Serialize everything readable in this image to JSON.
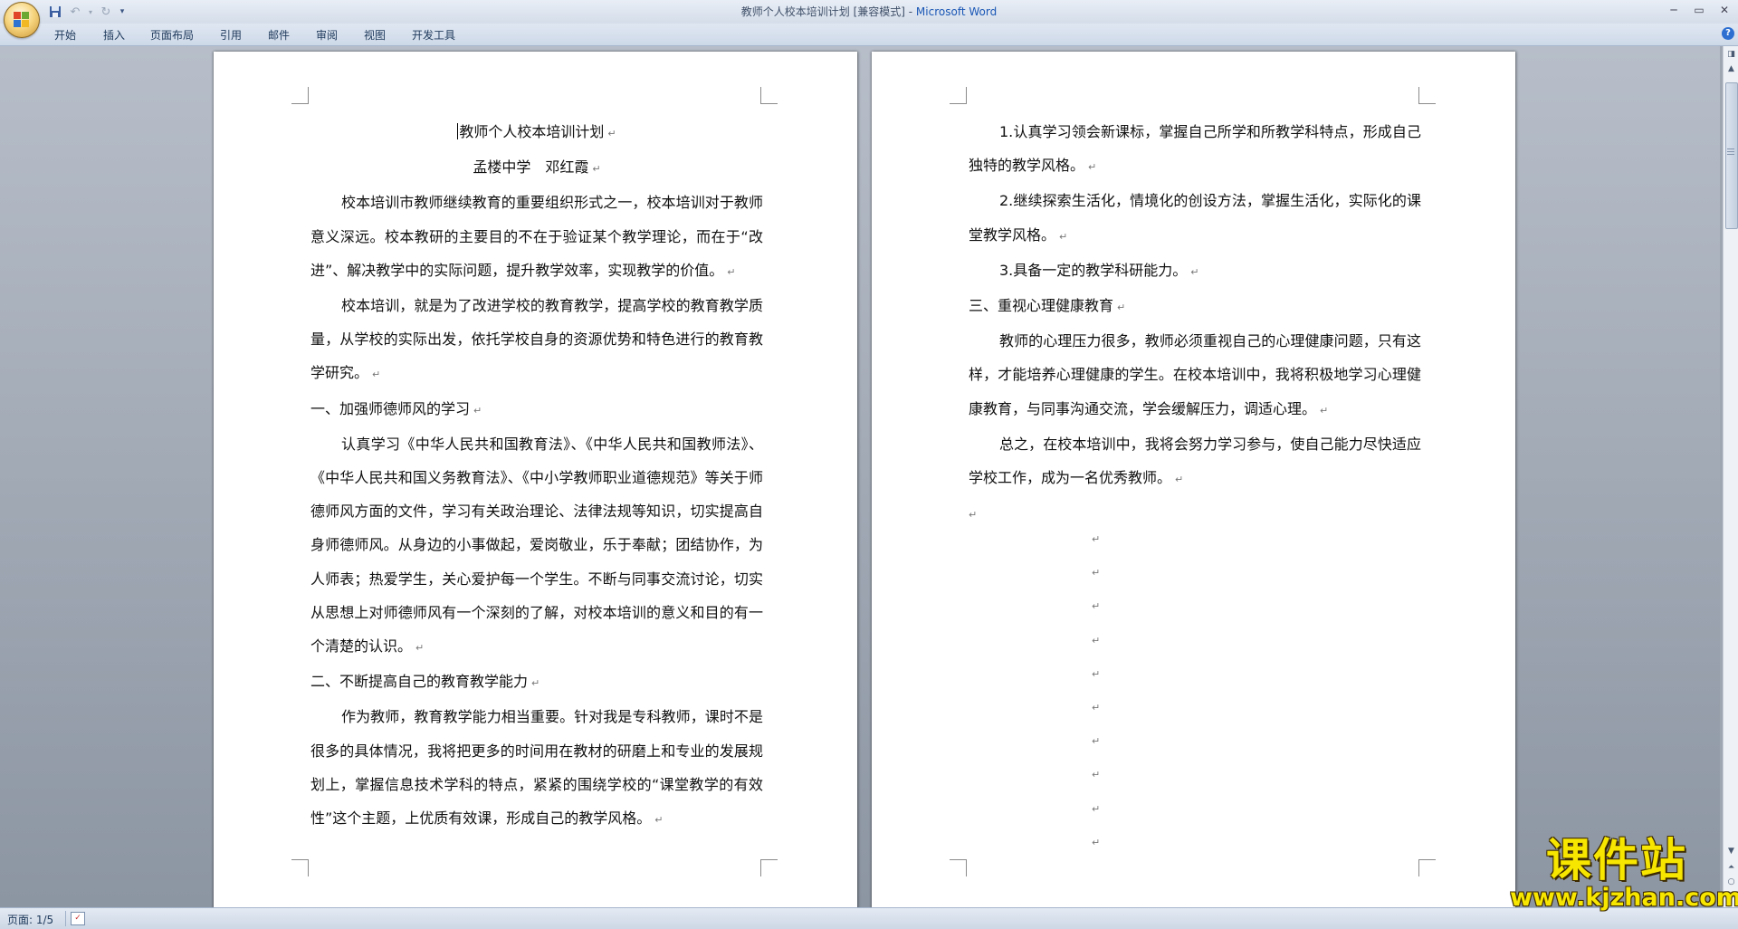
{
  "window": {
    "title_doc": "教师个人校本培训计划 [兼容模式] - ",
    "title_app": "Microsoft Word"
  },
  "ribbon": {
    "tabs": [
      "开始",
      "插入",
      "页面布局",
      "引用",
      "邮件",
      "审阅",
      "视图",
      "开发工具"
    ]
  },
  "document": {
    "page1": {
      "title": "教师个人校本培训计划",
      "author": "孟楼中学　邓红霞",
      "paragraphs": [
        "校本培训市教师继续教育的重要组织形式之一，校本培训对于教师意义深远。校本教研的主要目的不在于验证某个教学理论，而在于“改进”、解决教学中的实际问题，提升教学效率，实现教学的价值。",
        "校本培训，就是为了改进学校的教育教学，提高学校的教育教学质量，从学校的实际出发，依托学校自身的资源优势和特色进行的教育教学研究。",
        "一、加强师德师风的学习",
        "认真学习《中华人民共和国教育法》、《中华人民共和国教师法》、《中华人民共和国义务教育法》、《中小学教师职业道德规范》等关于师德师风方面的文件，学习有关政治理论、法律法规等知识，切实提高自身师德师风。从身边的小事做起，爱岗敬业，乐于奉献；团结协作，为人师表；热爱学生，关心爱护每一个学生。不断与同事交流讨论，切实从思想上对师德师风有一个深刻的了解，对校本培训的意义和目的有一个清楚的认识。",
        "二、不断提高自己的教育教学能力",
        "作为教师，教育教学能力相当重要。针对我是专科教师，课时不是很多的具体情况，我将把更多的时间用在教材的研磨上和专业的发展规划上，掌握信息技术学科的特点，紧紧的围绕学校的“课堂教学的有效性”这个主题，上优质有效课，形成自己的教学风格。"
      ]
    },
    "page2": {
      "paragraphs": [
        "1.认真学习领会新课标，掌握自己所学和所教学科特点，形成自己独特的教学风格。",
        "2.继续探索生活化，情境化的创设方法，掌握生活化，实际化的课堂教学风格。",
        "3.具备一定的教学科研能力。",
        "三、重视心理健康教育",
        "教师的心理压力很多，教师必须重视自己的心理健康问题，只有这样，才能培养心理健康的学生。在校本培训中，我将积极地学习心理健康教育，与同事沟通交流，学会缓解压力，调适心理。",
        "总之，在校本培训中，我将会努力学习参与，使自己能力尽快适应学校工作，成为一名优秀教师。"
      ]
    }
  },
  "statusbar": {
    "page_info": "页面: 1/5"
  },
  "watermark": {
    "big": "课件站",
    "url": "www.kjzhan.com"
  },
  "colors": {
    "workspace": "#9ea6b2",
    "ribbon": "#dfe7f2",
    "brand_title": "#1a57b5",
    "watermark": "#f7e600"
  }
}
